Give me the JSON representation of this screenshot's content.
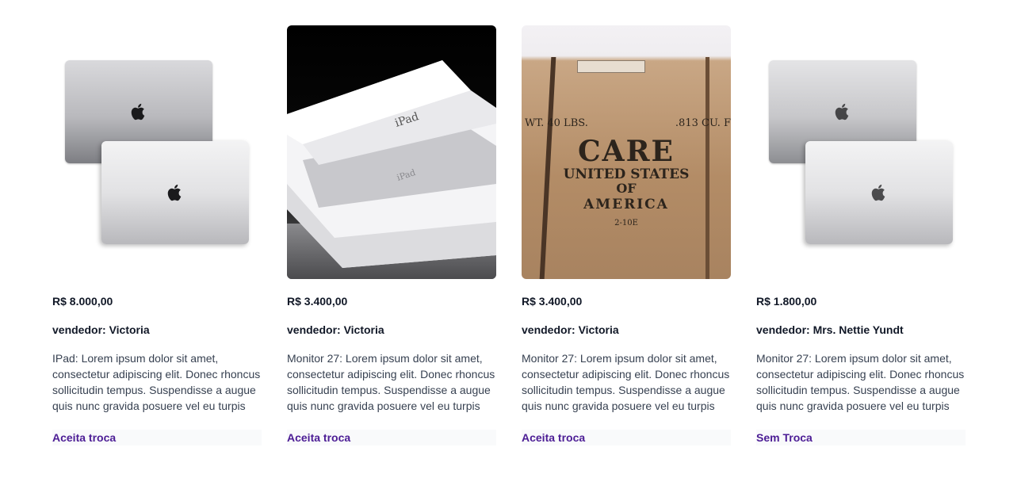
{
  "products": [
    {
      "image": "laptop-pair",
      "price": "R$ 8.000,00",
      "seller": "vendedor: Victoria",
      "description": "IPad: Lorem ipsum dolor sit amet, consectetur adipiscing elit. Donec rhoncus sollicitudin tempus. Suspendisse a augue quis nunc gravida posuere vel eu turpis",
      "trade": "Aceita troca"
    },
    {
      "image": "ipad-box",
      "price": "R$ 3.400,00",
      "seller": "vendedor: Victoria",
      "description": "Monitor 27: Lorem ipsum dolor sit amet, consectetur adipiscing elit. Donec rhoncus sollicitudin tempus. Suspendisse a augue quis nunc gravida posuere vel eu turpis",
      "trade": "Aceita troca"
    },
    {
      "image": "care-package",
      "price": "R$ 3.400,00",
      "seller": "vendedor: Victoria",
      "description": "Monitor 27: Lorem ipsum dolor sit amet, consectetur adipiscing elit. Donec rhoncus sollicitudin tempus. Suspendisse a augue quis nunc gravida posuere vel eu turpis",
      "trade": "Aceita troca",
      "image_text": {
        "weight": "WT. 40 LBS.",
        "cu": ".813 CU. F",
        "care": "CARE",
        "united_states": "UNITED STATES",
        "of": "OF",
        "america": "AMERICA",
        "code": "2-10E"
      }
    },
    {
      "image": "laptop-pair",
      "price": "R$ 1.800,00",
      "seller": "vendedor: Mrs. Nettie Yundt",
      "description": "Monitor 27: Lorem ipsum dolor sit amet, consectetur adipiscing elit. Donec rhoncus sollicitudin tempus. Suspendisse a augue quis nunc gravida posuere vel eu turpis",
      "trade": "Sem Troca"
    }
  ],
  "ipad_box_text": {
    "lid": "iPad",
    "inner": "iPad"
  },
  "colors": {
    "trade_link": "#4c1d95"
  }
}
